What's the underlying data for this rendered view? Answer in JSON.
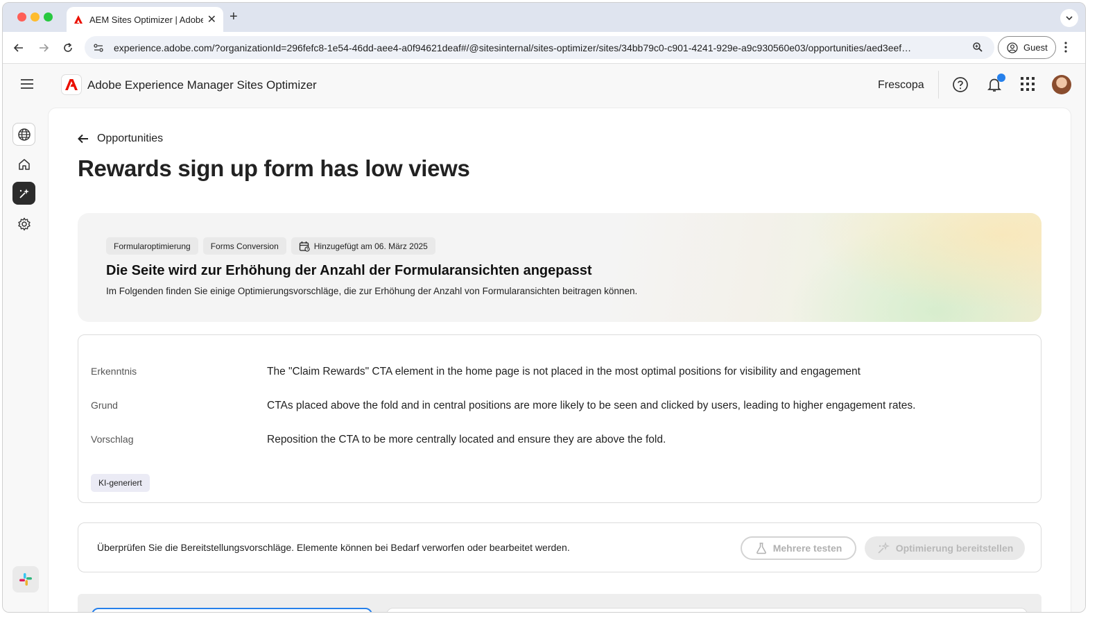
{
  "browser": {
    "tab_title": "AEM Sites Optimizer | Adobe",
    "url": "experience.adobe.com/?organizationId=296fefc8-1e54-46dd-aee4-a0f94621deaf#/@sitesinternal/sites-optimizer/sites/34bb79c0-c901-4241-929e-a9c930560e03/opportunities/aed3eef…",
    "profile_label": "Guest"
  },
  "app": {
    "name": "Adobe Experience Manager Sites Optimizer",
    "org": "Frescopa",
    "accent_color": "#eb1000"
  },
  "page": {
    "back_label": "Opportunities",
    "title": "Rewards sign up form has low views"
  },
  "hero": {
    "tags": [
      "Formularoptimierung",
      "Forms Conversion",
      "Hinzugefügt am 06. März 2025"
    ],
    "title": "Die Seite wird zur Erhöhung der Anzahl der Formularansichten angepasst",
    "subtitle": "Im Folgenden finden Sie einige Optimierungsvorschläge, die zur Erhöhung der Anzahl von Formularansichten beitragen können."
  },
  "insight": {
    "rows": [
      {
        "label": "Erkenntnis",
        "value": "The \"Claim Rewards\" CTA element in the home page is not placed in the most optimal positions for visibility and engagement"
      },
      {
        "label": "Grund",
        "value": "CTAs placed above the fold and in central positions are more likely to be seen and clicked by users, leading to higher engagement rates."
      },
      {
        "label": "Vorschlag",
        "value": "Reposition the CTA to be more centrally located and ensure they are above the fold."
      }
    ],
    "badge": "KI-generiert"
  },
  "deploy": {
    "text": "Überprüfen Sie die Bereitstellungsvorschläge. Elemente können bei Bedarf verworfen oder bearbeitet werden.",
    "test_label": "Mehrere testen",
    "deploy_label": "Optimierung bereitstellen"
  }
}
